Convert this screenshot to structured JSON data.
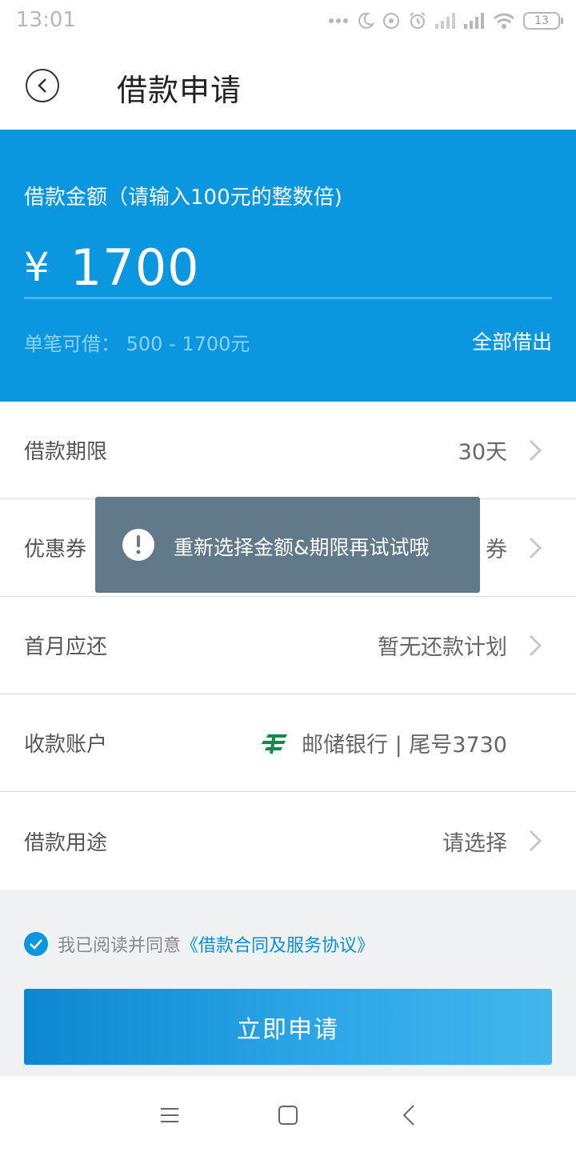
{
  "status_bar": {
    "time": "13:01",
    "battery": "13",
    "icons": [
      "more-icon",
      "moon-icon",
      "headset-icon",
      "alarm-icon",
      "signal-icon",
      "signal-icon",
      "wifi-icon",
      "battery-icon"
    ]
  },
  "header": {
    "title": "借款申请",
    "back_icon": "back-circle-icon"
  },
  "amount": {
    "label": "借款金额（请输入100元的整数倍)",
    "currency": "¥",
    "value": "1700",
    "range_label": "单笔可借： 500 - 1700元",
    "borrow_all": "全部借出"
  },
  "rows": [
    {
      "label": "借款期限",
      "value": "30天"
    },
    {
      "label": "优惠券",
      "value": "券"
    },
    {
      "label": "首月应还",
      "value": "暂无还款计划"
    },
    {
      "label": "收款账户",
      "value": "邮储银行 | 尾号3730",
      "icon": "postal-bank-logo"
    },
    {
      "label": "借款用途",
      "value": "请选择"
    }
  ],
  "agreement": {
    "text": "我已阅读并同意",
    "link": "《借款合同及服务协议》",
    "checked": true
  },
  "apply_button": "立即申请",
  "toast": {
    "text": "重新选择金额&期限再试试哦",
    "icon": "exclamation-icon"
  },
  "nav_bar": [
    "menu-icon",
    "home-square-icon",
    "back-icon"
  ],
  "colors": {
    "primary": "#0a97e0",
    "toast": "#607a89",
    "page_bg": "#f0f1f3"
  }
}
